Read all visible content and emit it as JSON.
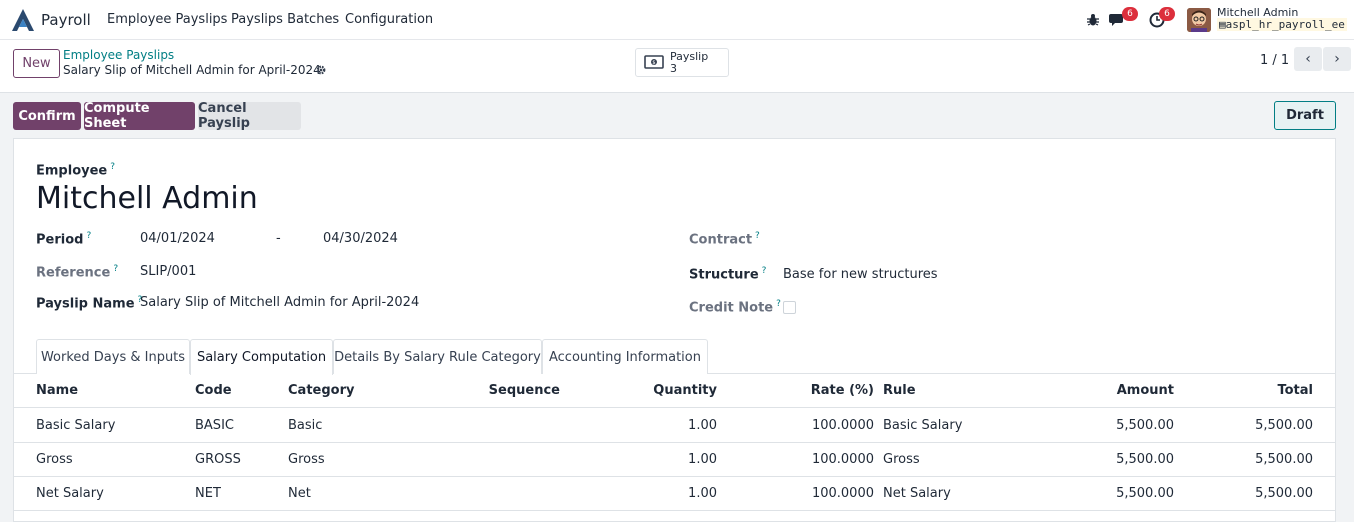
{
  "navbar": {
    "app_name": "Payroll",
    "menu": [
      "Employee Payslips",
      "Payslips Batches",
      "Configuration"
    ],
    "messages_count": "6",
    "activities_count": "6",
    "user_name": "Mitchell Admin",
    "database": "aspl_hr_payroll_ee",
    "icons": [
      "payroll-logo-icon",
      "bug-icon",
      "chat-icon",
      "clock-icon"
    ]
  },
  "control": {
    "new_label": "New",
    "breadcrumb_parent": "Employee Payslips",
    "breadcrumb_current": "Salary Slip of Mitchell Admin for April-2024",
    "smart_button_label": "Payslip",
    "smart_button_value": "3",
    "pager_text": "1 / 1"
  },
  "statusbar": {
    "confirm_label": "Confirm",
    "compute_label": "Compute Sheet",
    "cancel_label": "Cancel Payslip",
    "state_label": "Draft"
  },
  "form": {
    "employee_label": "Employee",
    "employee_name": "Mitchell Admin",
    "period_label": "Period",
    "period_from": "04/01/2024",
    "period_sep": "-",
    "period_to": "04/30/2024",
    "reference_label": "Reference",
    "reference_value": "SLIP/001",
    "payslip_name_label": "Payslip Name",
    "payslip_name_value": "Salary Slip of Mitchell Admin for April-2024",
    "contract_label": "Contract",
    "structure_label": "Structure",
    "structure_value": "Base for new structures",
    "credit_note_label": "Credit Note",
    "help_mark": "?"
  },
  "tabs": [
    "Worked Days & Inputs",
    "Salary Computation",
    "Details By Salary Rule Category",
    "Accounting Information"
  ],
  "active_tab": "Salary Computation",
  "table": {
    "headers": [
      "Name",
      "Code",
      "Category",
      "Sequence",
      "Quantity",
      "Rate (%)",
      "Rule",
      "Amount",
      "Total"
    ],
    "rows": [
      {
        "name": "Basic Salary",
        "code": "BASIC",
        "category": "Basic",
        "sequence": "",
        "quantity": "1.00",
        "rate": "100.0000",
        "rule": "Basic Salary",
        "amount": "5,500.00",
        "total": "5,500.00"
      },
      {
        "name": "Gross",
        "code": "GROSS",
        "category": "Gross",
        "sequence": "",
        "quantity": "1.00",
        "rate": "100.0000",
        "rule": "Gross",
        "amount": "5,500.00",
        "total": "5,500.00"
      },
      {
        "name": "Net Salary",
        "code": "NET",
        "category": "Net",
        "sequence": "",
        "quantity": "1.00",
        "rate": "100.0000",
        "rule": "Net Salary",
        "amount": "5,500.00",
        "total": "5,500.00"
      }
    ]
  },
  "colors": {
    "primary": "#71416a",
    "link": "#017e84",
    "badge": "#dc2f3c"
  }
}
